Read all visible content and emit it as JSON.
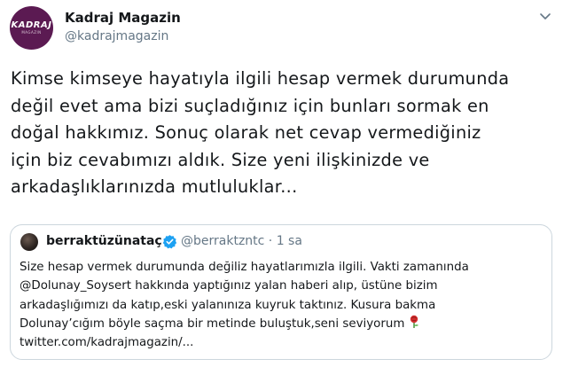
{
  "author": {
    "name": "Kadraj Magazin",
    "handle": "@kadrajmagazin",
    "logo_text": "KADRAJ",
    "logo_subtext": "MAGAZIN"
  },
  "tweet": {
    "lines": [
      "Kimse kimseye hayatıyla ilgili hesap vermek durumunda",
      "değil evet ama bizi suçladığınız için bunları sormak en",
      "doğal hakkımız. Sonuç olarak net cevap vermediğiniz",
      "için biz cevabımızı aldık. Size yeni ilişkinizde ve",
      "arkadaşlıklarınızda mutluluklar..."
    ]
  },
  "quoted": {
    "name": "berraktüzünataç",
    "handle_time": "@berraktzntc · 1 sa",
    "lines": [
      "Size hesap vermek durumunda değiliz hayatlarımızla ilgili. Vakti zamanında",
      "@Dolunay_Soysert hakkında yaptığınız yalan haberi alıp, üstüne bizim",
      "arkadaşlığımızı da katıp,eski yalanınıza kuyruk taktınız. Kusura bakma",
      "Dolunay’cığım böyle saçma bir metinde buluştuk,seni seviyorum",
      "twitter.com/kadrajmagazin/..."
    ]
  },
  "colors": {
    "primary_text": "#14171a",
    "secondary_text": "#657786",
    "border": "#ccd6dd",
    "verified": "#1da1f2",
    "avatar_bg": "#5b1a52"
  },
  "icons": {
    "caret": "chevron-down-icon",
    "verified": "verified-badge-icon",
    "rose": "rose-emoji-icon"
  }
}
